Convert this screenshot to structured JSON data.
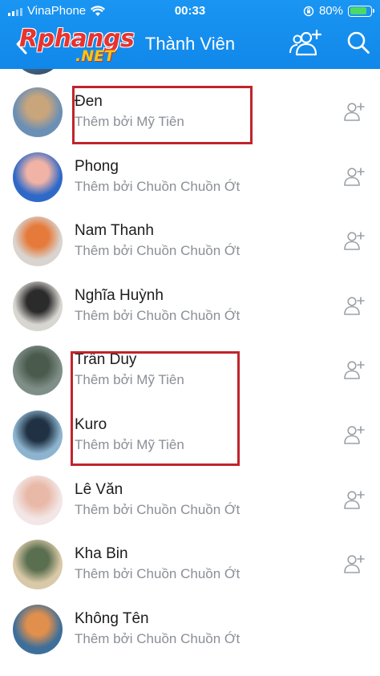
{
  "status_bar": {
    "carrier": "VinaPhone",
    "time": "00:33",
    "battery": "80%",
    "battery_level": 0.8
  },
  "header": {
    "title": "Thành Viên",
    "logo_main": "Rphangs",
    "logo_sub": ".NET",
    "icons": [
      "chevron-left-icon",
      "add-member-icon",
      "search-icon"
    ]
  },
  "members": [
    {
      "name": "Đen",
      "added_by": "Thêm bởi Mỹ Tiên",
      "avatar_colors": [
        "#6b8fb5",
        "#c9a57c"
      ]
    },
    {
      "name": "Phong",
      "added_by": "Thêm bởi Chuồn Chuồn Ớt",
      "avatar_colors": [
        "#2f69c8",
        "#f1b3a6"
      ]
    },
    {
      "name": "Nam Thanh",
      "added_by": "Thêm bởi Chuồn Chuồn Ớt",
      "avatar_colors": [
        "#d9d4cf",
        "#e57a3b"
      ]
    },
    {
      "name": "Nghĩa Huỳnh",
      "added_by": "Thêm bởi Chuồn Chuồn Ớt",
      "avatar_colors": [
        "#d8d6d1",
        "#2b2b2b"
      ]
    },
    {
      "name": "Trần Duy",
      "added_by": "Thêm bởi Mỹ Tiên",
      "avatar_colors": [
        "#7f8f88",
        "#4a5a4c"
      ]
    },
    {
      "name": "Kuro",
      "added_by": "Thêm bởi Mỹ Tiên",
      "avatar_colors": [
        "#8db4cf",
        "#1f3142"
      ]
    },
    {
      "name": "Lê Văn",
      "added_by": "Thêm bởi Chuồn Chuồn Ớt",
      "avatar_colors": [
        "#f2e6e6",
        "#e9b9a8"
      ]
    },
    {
      "name": "Kha Bin",
      "added_by": "Thêm bởi Chuồn Chuồn Ớt",
      "avatar_colors": [
        "#d9c9a8",
        "#5a6f4f"
      ]
    },
    {
      "name": "Không Tên",
      "added_by": "Thêm bởi Chuồn Chuồn Ớt",
      "avatar_colors": [
        "#3e6f9a",
        "#e08f4c"
      ]
    }
  ],
  "colors": {
    "header": "#1a8ff0",
    "highlight": "#c0242c",
    "name_text": "#1c1c1c",
    "sub_text": "#8a8f96",
    "icon_gray": "#9aa0a6"
  }
}
